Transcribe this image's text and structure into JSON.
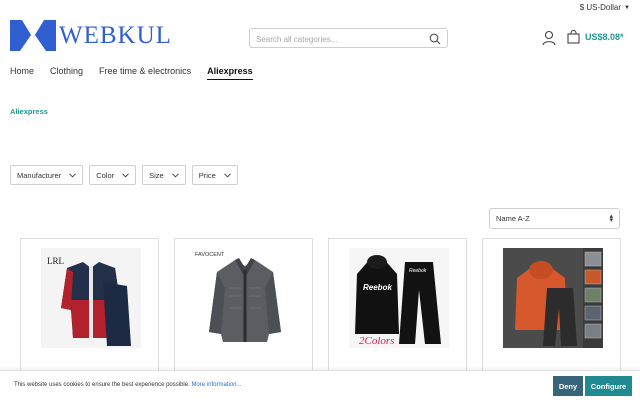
{
  "topbar": {
    "currency": "$ US-Dollar"
  },
  "header": {
    "logo_text": "WEBKUL",
    "search_placeholder": "Search all categories...",
    "cart_total": "US$8.08*"
  },
  "nav": {
    "items": [
      {
        "label": "Home"
      },
      {
        "label": "Clothing"
      },
      {
        "label": "Free time & electronics"
      },
      {
        "label": "Aliexpress"
      }
    ],
    "active": "Aliexpress"
  },
  "breadcrumb": "Aliexpress",
  "filters": [
    {
      "label": "Manufacturer"
    },
    {
      "label": "Color"
    },
    {
      "label": "Size"
    },
    {
      "label": "Price"
    }
  ],
  "sort": {
    "selected": "Name A-Z"
  },
  "products": [
    {
      "image": "red-black-tracksuit",
      "image_label": "LRL"
    },
    {
      "image": "grey-knit-jacket",
      "image_label": "FAVOCENT"
    },
    {
      "image": "black-hoodie-tracksuit",
      "image_label": "Reebok",
      "overlay_text": "2Colors"
    },
    {
      "image": "orange-hoodie-tracksuit"
    }
  ],
  "cookie": {
    "text": "This website uses cookies to ensure the best experience possible.",
    "link": "More information...",
    "deny": "Deny",
    "configure": "Configure"
  },
  "colors": {
    "accent": "#1f9a8f",
    "brand": "#2f5fd0",
    "deny": "#37647a",
    "configure": "#1f8a8f"
  }
}
